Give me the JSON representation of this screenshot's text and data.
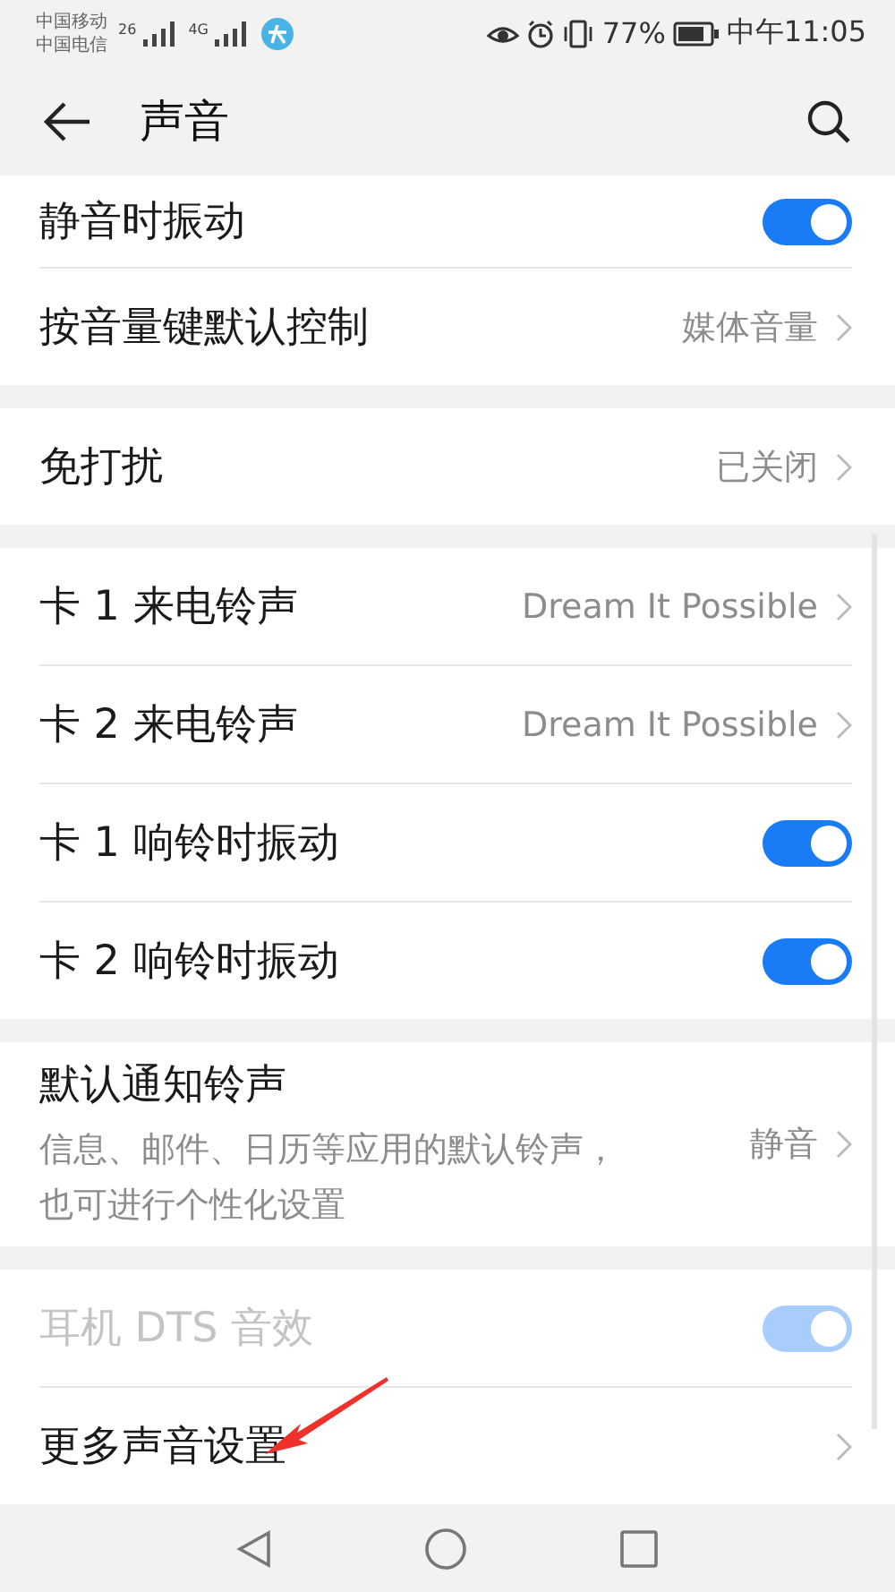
{
  "status_bar": {
    "carriers": [
      "中国移动",
      "中国电信"
    ],
    "signals": [
      "26",
      "4G"
    ],
    "battery_text": "77%",
    "time": "中午11:05"
  },
  "header": {
    "title": "声音"
  },
  "sections": [
    {
      "rows": [
        {
          "kind": "toggle",
          "label": "静音时振动",
          "on": true,
          "disabled": false
        },
        {
          "kind": "value",
          "label": "按音量键默认控制",
          "value": "媒体音量"
        }
      ]
    },
    {
      "rows": [
        {
          "kind": "value",
          "label": "免打扰",
          "value": "已关闭"
        }
      ]
    },
    {
      "rows": [
        {
          "kind": "value",
          "label": "卡 1 来电铃声",
          "value": "Dream It Possible"
        },
        {
          "kind": "value",
          "label": "卡 2 来电铃声",
          "value": "Dream It Possible"
        },
        {
          "kind": "toggle",
          "label": "卡 1 响铃时振动",
          "on": true,
          "disabled": false
        },
        {
          "kind": "toggle",
          "label": "卡 2 响铃时振动",
          "on": true,
          "disabled": false
        }
      ]
    },
    {
      "rows": [
        {
          "kind": "value",
          "label": "默认通知铃声",
          "description": "信息、邮件、日历等应用的默认铃声，也可进行个性化设置",
          "value": "静音"
        }
      ]
    },
    {
      "rows": [
        {
          "kind": "toggle",
          "label": "耳机 DTS 音效",
          "on": true,
          "disabled": true
        },
        {
          "kind": "nav",
          "label": "更多声音设置"
        }
      ]
    }
  ]
}
